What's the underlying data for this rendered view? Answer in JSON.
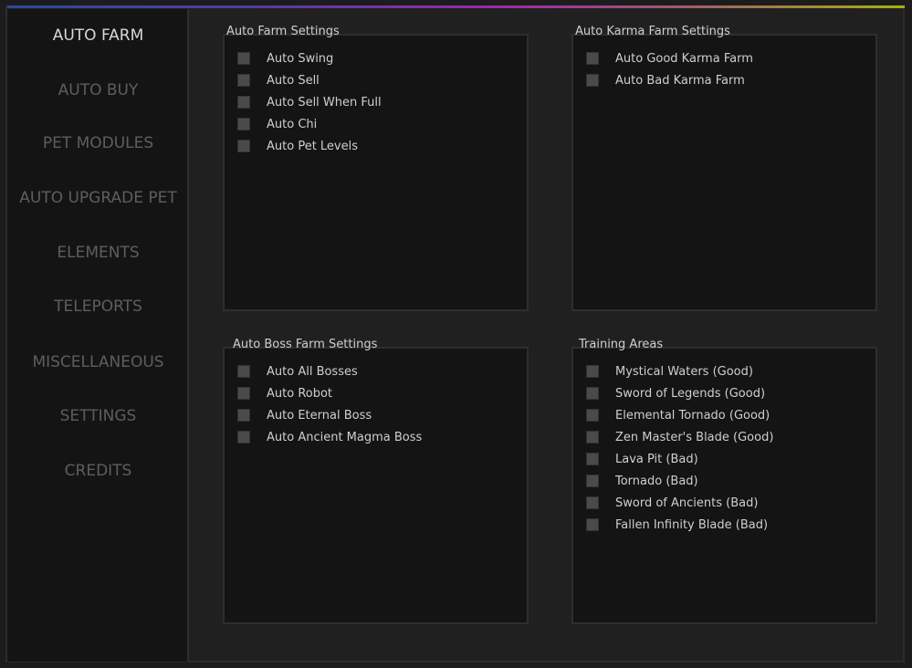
{
  "sidebar": {
    "items": [
      {
        "label": "AUTO FARM",
        "active": true
      },
      {
        "label": "AUTO BUY"
      },
      {
        "label": "PET MODULES"
      },
      {
        "label": "AUTO UPGRADE PET"
      },
      {
        "label": "ELEMENTS"
      },
      {
        "label": "TELEPORTS"
      },
      {
        "label": "MISCELLANEOUS"
      },
      {
        "label": "SETTINGS"
      },
      {
        "label": "CREDITS"
      }
    ]
  },
  "panels": {
    "auto_farm": {
      "title": "Auto Farm Settings",
      "items": [
        "Auto Swing",
        "Auto Sell",
        "Auto Sell When Full",
        "Auto Chi",
        "Auto Pet Levels"
      ]
    },
    "karma": {
      "title": "Auto Karma Farm Settings",
      "items": [
        "Auto Good Karma Farm",
        "Auto Bad Karma Farm"
      ]
    },
    "boss": {
      "title": "Auto Boss Farm Settings",
      "items": [
        "Auto All Bosses",
        "Auto Robot",
        "Auto Eternal  Boss",
        "Auto Ancient Magma Boss"
      ]
    },
    "training": {
      "title": "Training Areas",
      "items": [
        "Mystical Waters (Good)",
        "Sword of Legends (Good)",
        "Elemental Tornado (Good)",
        "Zen Master's Blade (Good)",
        "Lava Pit (Bad)",
        "Tornado (Bad)",
        "Sword of Ancients (Bad)",
        "Fallen Infinity Blade (Bad)"
      ]
    }
  },
  "colors": {
    "checkbox": "#4a4a4a",
    "panel_bg": "#141414",
    "window_bg": "#202020",
    "active_text": "#d8d8d8",
    "inactive_text": "#5e5e5e"
  }
}
